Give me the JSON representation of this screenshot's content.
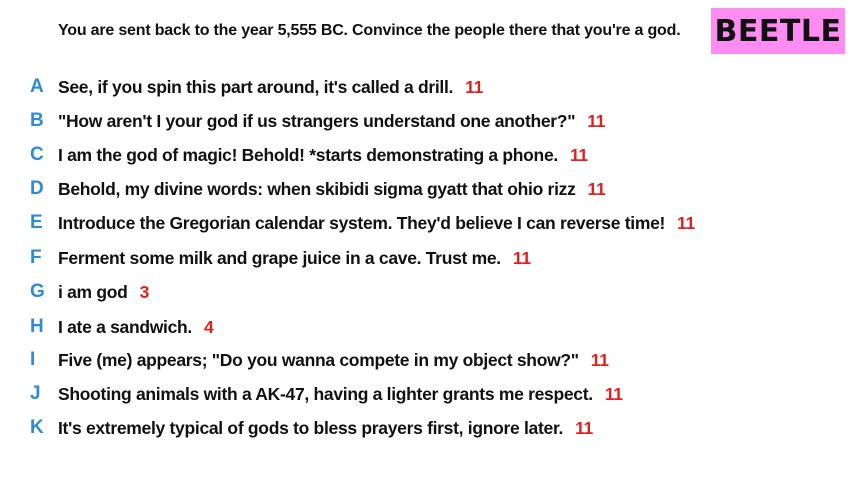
{
  "prompt": "You are sent back to the year 5,555 BC. Convince the people there that you're a god.",
  "badge": "BEETLE",
  "colors": {
    "letter": "#2f8bd6",
    "score": "#e0201e",
    "badge_bg": "#ff8cf2"
  },
  "answers": [
    {
      "letter": "A",
      "text": "See, if you spin this part around, it's called a drill.",
      "score": "11"
    },
    {
      "letter": "B",
      "text": "\"How aren't I your god if us strangers understand one another?\"",
      "score": "11"
    },
    {
      "letter": "C",
      "text": "I am the god of magic! Behold! *starts demonstrating a phone.",
      "score": "11"
    },
    {
      "letter": "D",
      "text": "Behold, my divine words: when skibidi sigma gyatt that ohio rizz",
      "score": "11"
    },
    {
      "letter": "E",
      "text": "Introduce the Gregorian calendar system. They'd believe I can reverse time!",
      "score": "11"
    },
    {
      "letter": "F",
      "text": "Ferment some milk and grape juice in a cave. Trust me.",
      "score": "11"
    },
    {
      "letter": "G",
      "text": "i am god",
      "score": "3"
    },
    {
      "letter": "H",
      "text": "I ate a sandwich.",
      "score": "4"
    },
    {
      "letter": "I",
      "text": "Five (me) appears; \"Do you wanna compete in my object show?\"",
      "score": "11"
    },
    {
      "letter": "J",
      "text": "Shooting animals with a AK-47, having a lighter grants me respect.",
      "score": "11"
    },
    {
      "letter": "K",
      "text": "It's extremely typical of gods to bless prayers first, ignore later.",
      "score": "11"
    }
  ]
}
